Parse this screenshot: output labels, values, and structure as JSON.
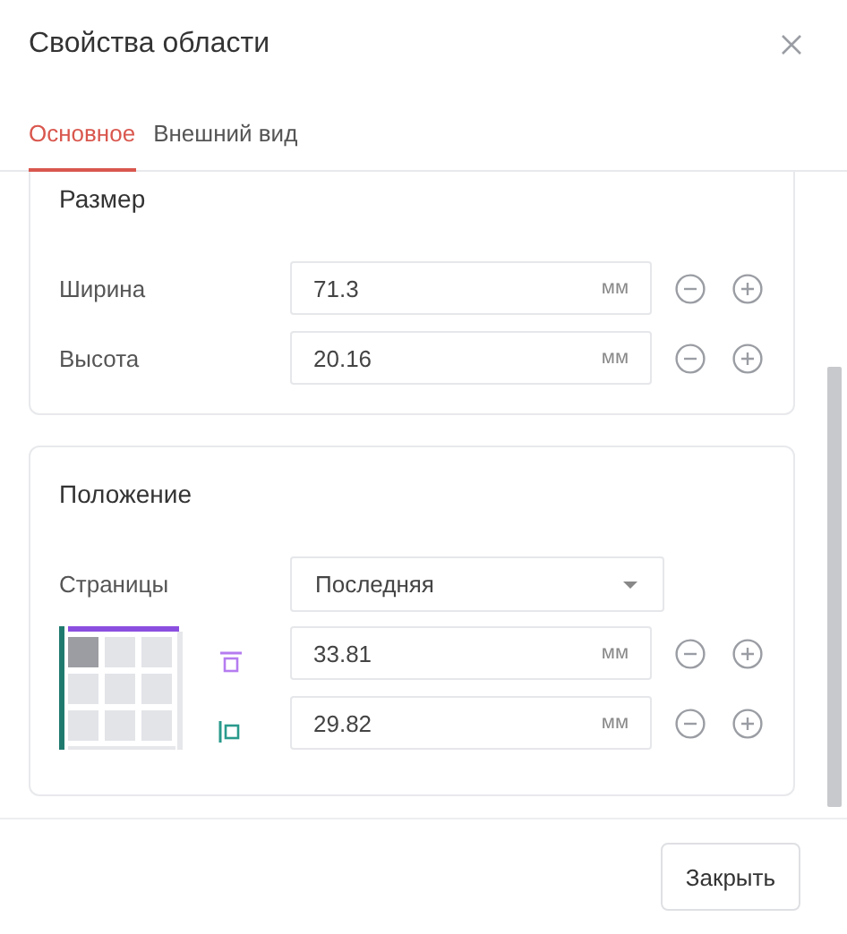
{
  "window": {
    "title": "Свойства области"
  },
  "tabs": [
    {
      "label": "Основное",
      "selected": true
    },
    {
      "label": "Внешний вид",
      "selected": false
    }
  ],
  "size_section": {
    "title": "Размер",
    "fields": [
      {
        "label": "Ширина",
        "value": "71.3",
        "unit": "мм"
      },
      {
        "label": "Высота",
        "value": "20.16",
        "unit": "мм"
      }
    ]
  },
  "position_section": {
    "title": "Положение",
    "pages": {
      "label": "Страницы",
      "value": "Последняя"
    },
    "anchor_cells": [
      {
        "selected": true
      },
      {
        "selected": false
      },
      {
        "selected": false
      },
      {
        "selected": false
      },
      {
        "selected": false
      },
      {
        "selected": false
      },
      {
        "selected": false
      },
      {
        "selected": false
      },
      {
        "selected": false
      }
    ],
    "offsets": [
      {
        "kind": "top",
        "value": "33.81",
        "unit": "мм"
      },
      {
        "kind": "left",
        "value": "29.82",
        "unit": "мм"
      }
    ]
  },
  "buttons": [
    {
      "label": "Закрыть"
    }
  ]
}
